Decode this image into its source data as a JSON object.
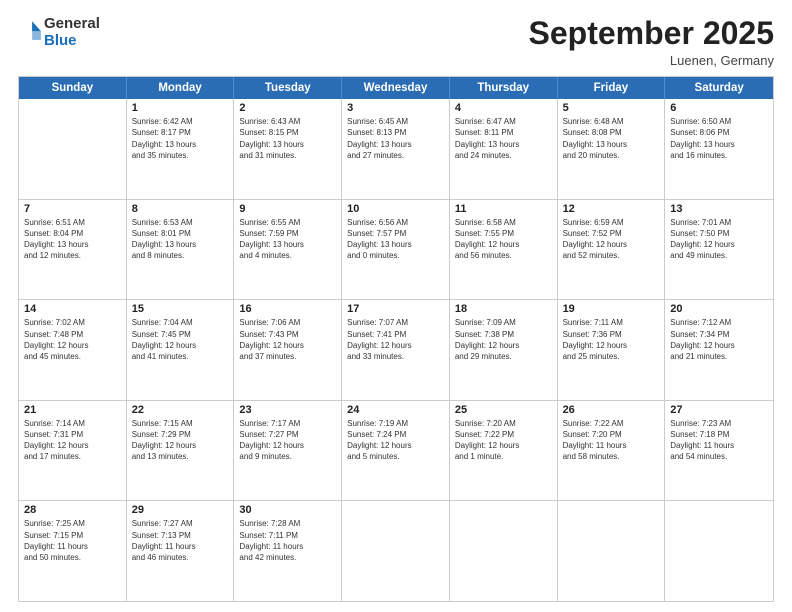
{
  "header": {
    "logo_general": "General",
    "logo_blue": "Blue",
    "month_title": "September 2025",
    "location": "Luenen, Germany"
  },
  "days_of_week": [
    "Sunday",
    "Monday",
    "Tuesday",
    "Wednesday",
    "Thursday",
    "Friday",
    "Saturday"
  ],
  "weeks": [
    [
      {
        "day": "",
        "info": ""
      },
      {
        "day": "1",
        "info": "Sunrise: 6:42 AM\nSunset: 8:17 PM\nDaylight: 13 hours\nand 35 minutes."
      },
      {
        "day": "2",
        "info": "Sunrise: 6:43 AM\nSunset: 8:15 PM\nDaylight: 13 hours\nand 31 minutes."
      },
      {
        "day": "3",
        "info": "Sunrise: 6:45 AM\nSunset: 8:13 PM\nDaylight: 13 hours\nand 27 minutes."
      },
      {
        "day": "4",
        "info": "Sunrise: 6:47 AM\nSunset: 8:11 PM\nDaylight: 13 hours\nand 24 minutes."
      },
      {
        "day": "5",
        "info": "Sunrise: 6:48 AM\nSunset: 8:08 PM\nDaylight: 13 hours\nand 20 minutes."
      },
      {
        "day": "6",
        "info": "Sunrise: 6:50 AM\nSunset: 8:06 PM\nDaylight: 13 hours\nand 16 minutes."
      }
    ],
    [
      {
        "day": "7",
        "info": "Sunrise: 6:51 AM\nSunset: 8:04 PM\nDaylight: 13 hours\nand 12 minutes."
      },
      {
        "day": "8",
        "info": "Sunrise: 6:53 AM\nSunset: 8:01 PM\nDaylight: 13 hours\nand 8 minutes."
      },
      {
        "day": "9",
        "info": "Sunrise: 6:55 AM\nSunset: 7:59 PM\nDaylight: 13 hours\nand 4 minutes."
      },
      {
        "day": "10",
        "info": "Sunrise: 6:56 AM\nSunset: 7:57 PM\nDaylight: 13 hours\nand 0 minutes."
      },
      {
        "day": "11",
        "info": "Sunrise: 6:58 AM\nSunset: 7:55 PM\nDaylight: 12 hours\nand 56 minutes."
      },
      {
        "day": "12",
        "info": "Sunrise: 6:59 AM\nSunset: 7:52 PM\nDaylight: 12 hours\nand 52 minutes."
      },
      {
        "day": "13",
        "info": "Sunrise: 7:01 AM\nSunset: 7:50 PM\nDaylight: 12 hours\nand 49 minutes."
      }
    ],
    [
      {
        "day": "14",
        "info": "Sunrise: 7:02 AM\nSunset: 7:48 PM\nDaylight: 12 hours\nand 45 minutes."
      },
      {
        "day": "15",
        "info": "Sunrise: 7:04 AM\nSunset: 7:45 PM\nDaylight: 12 hours\nand 41 minutes."
      },
      {
        "day": "16",
        "info": "Sunrise: 7:06 AM\nSunset: 7:43 PM\nDaylight: 12 hours\nand 37 minutes."
      },
      {
        "day": "17",
        "info": "Sunrise: 7:07 AM\nSunset: 7:41 PM\nDaylight: 12 hours\nand 33 minutes."
      },
      {
        "day": "18",
        "info": "Sunrise: 7:09 AM\nSunset: 7:38 PM\nDaylight: 12 hours\nand 29 minutes."
      },
      {
        "day": "19",
        "info": "Sunrise: 7:11 AM\nSunset: 7:36 PM\nDaylight: 12 hours\nand 25 minutes."
      },
      {
        "day": "20",
        "info": "Sunrise: 7:12 AM\nSunset: 7:34 PM\nDaylight: 12 hours\nand 21 minutes."
      }
    ],
    [
      {
        "day": "21",
        "info": "Sunrise: 7:14 AM\nSunset: 7:31 PM\nDaylight: 12 hours\nand 17 minutes."
      },
      {
        "day": "22",
        "info": "Sunrise: 7:15 AM\nSunset: 7:29 PM\nDaylight: 12 hours\nand 13 minutes."
      },
      {
        "day": "23",
        "info": "Sunrise: 7:17 AM\nSunset: 7:27 PM\nDaylight: 12 hours\nand 9 minutes."
      },
      {
        "day": "24",
        "info": "Sunrise: 7:19 AM\nSunset: 7:24 PM\nDaylight: 12 hours\nand 5 minutes."
      },
      {
        "day": "25",
        "info": "Sunrise: 7:20 AM\nSunset: 7:22 PM\nDaylight: 12 hours\nand 1 minute."
      },
      {
        "day": "26",
        "info": "Sunrise: 7:22 AM\nSunset: 7:20 PM\nDaylight: 11 hours\nand 58 minutes."
      },
      {
        "day": "27",
        "info": "Sunrise: 7:23 AM\nSunset: 7:18 PM\nDaylight: 11 hours\nand 54 minutes."
      }
    ],
    [
      {
        "day": "28",
        "info": "Sunrise: 7:25 AM\nSunset: 7:15 PM\nDaylight: 11 hours\nand 50 minutes."
      },
      {
        "day": "29",
        "info": "Sunrise: 7:27 AM\nSunset: 7:13 PM\nDaylight: 11 hours\nand 46 minutes."
      },
      {
        "day": "30",
        "info": "Sunrise: 7:28 AM\nSunset: 7:11 PM\nDaylight: 11 hours\nand 42 minutes."
      },
      {
        "day": "",
        "info": ""
      },
      {
        "day": "",
        "info": ""
      },
      {
        "day": "",
        "info": ""
      },
      {
        "day": "",
        "info": ""
      }
    ]
  ]
}
